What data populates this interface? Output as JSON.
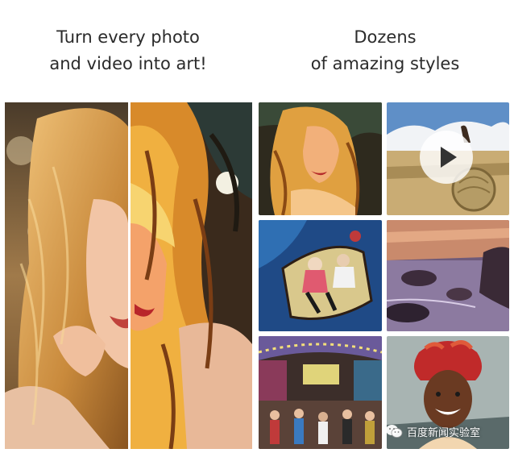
{
  "left_headline": {
    "line1": "Turn every photo",
    "line2": "and video into art!"
  },
  "right_headline": {
    "line1": "Dozens",
    "line2": "of amazing styles"
  },
  "watermark": {
    "text": "百度新闻实验室",
    "icon": "wechat-logo-icon"
  },
  "video_tile": {
    "icon": "play-icon"
  }
}
